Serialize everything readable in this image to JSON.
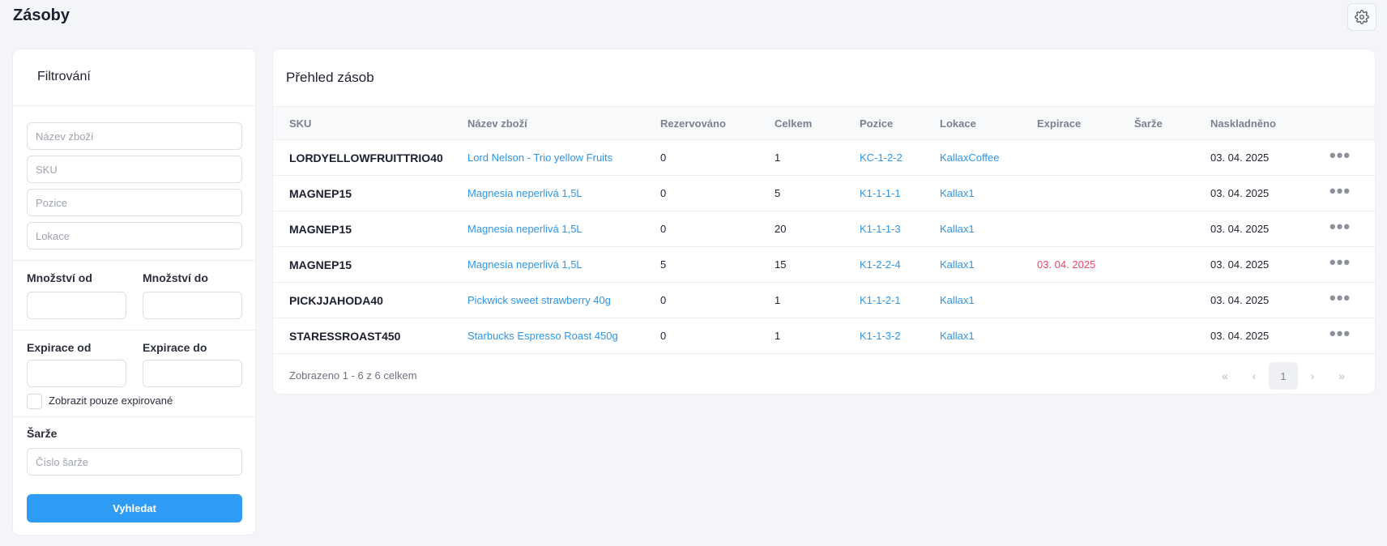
{
  "page": {
    "title": "Zásoby"
  },
  "icons": {
    "settings": "gear-icon"
  },
  "filter": {
    "title": "Filtrování",
    "name_placeholder": "Název zboží",
    "sku_placeholder": "SKU",
    "position_placeholder": "Pozice",
    "location_placeholder": "Lokace",
    "qty_from_label": "Množství od",
    "qty_to_label": "Množství do",
    "exp_from_label": "Expirace od",
    "exp_to_label": "Expirace do",
    "expired_only_label": "Zobrazit pouze expirované",
    "batch_label": "Šarže",
    "batch_placeholder": "Číslo šarže",
    "search_button": "Vyhledat"
  },
  "overview": {
    "title": "Přehled zásob",
    "columns": [
      "SKU",
      "Název zboží",
      "Rezervováno",
      "Celkem",
      "Pozice",
      "Lokace",
      "Expirace",
      "Šarže",
      "Naskladněno"
    ],
    "rows": [
      {
        "sku": "LORDYELLOWFRUITTRIO40",
        "name": "Lord Nelson - Trio yellow Fruits",
        "reserved": "0",
        "total": "1",
        "position": "KC-1-2-2",
        "location": "KallaxCoffee",
        "expiration": "",
        "batch": "",
        "stocked": "03. 04. 2025"
      },
      {
        "sku": "MAGNEP15",
        "name": "Magnesia neperlivá 1,5L",
        "reserved": "0",
        "total": "5",
        "position": "K1-1-1-1",
        "location": "Kallax1",
        "expiration": "",
        "batch": "",
        "stocked": "03. 04. 2025"
      },
      {
        "sku": "MAGNEP15",
        "name": "Magnesia neperlivá 1,5L",
        "reserved": "0",
        "total": "20",
        "position": "K1-1-1-3",
        "location": "Kallax1",
        "expiration": "",
        "batch": "",
        "stocked": "03. 04. 2025"
      },
      {
        "sku": "MAGNEP15",
        "name": "Magnesia neperlivá 1,5L",
        "reserved": "5",
        "total": "15",
        "position": "K1-2-2-4",
        "location": "Kallax1",
        "expiration": "03. 04. 2025",
        "batch": "",
        "stocked": "03. 04. 2025"
      },
      {
        "sku": "PICKJJAHODA40",
        "name": "Pickwick sweet strawberry 40g",
        "reserved": "0",
        "total": "1",
        "position": "K1-1-2-1",
        "location": "Kallax1",
        "expiration": "",
        "batch": "",
        "stocked": "03. 04. 2025"
      },
      {
        "sku": "STARESSROAST450",
        "name": "Starbucks Espresso Roast 450g",
        "reserved": "0",
        "total": "1",
        "position": "K1-1-3-2",
        "location": "Kallax1",
        "expiration": "",
        "batch": "",
        "stocked": "03. 04. 2025"
      }
    ],
    "footer_info": "Zobrazeno 1 - 6 z 6 celkem",
    "pager": {
      "first": "«",
      "prev": "‹",
      "current": "1",
      "next": "›",
      "last": "»"
    },
    "row_menu_icon": "more-dots-icon"
  },
  "colors": {
    "accent": "#2e9bf5",
    "link": "#2e95e8",
    "expired": "#ee4466"
  }
}
